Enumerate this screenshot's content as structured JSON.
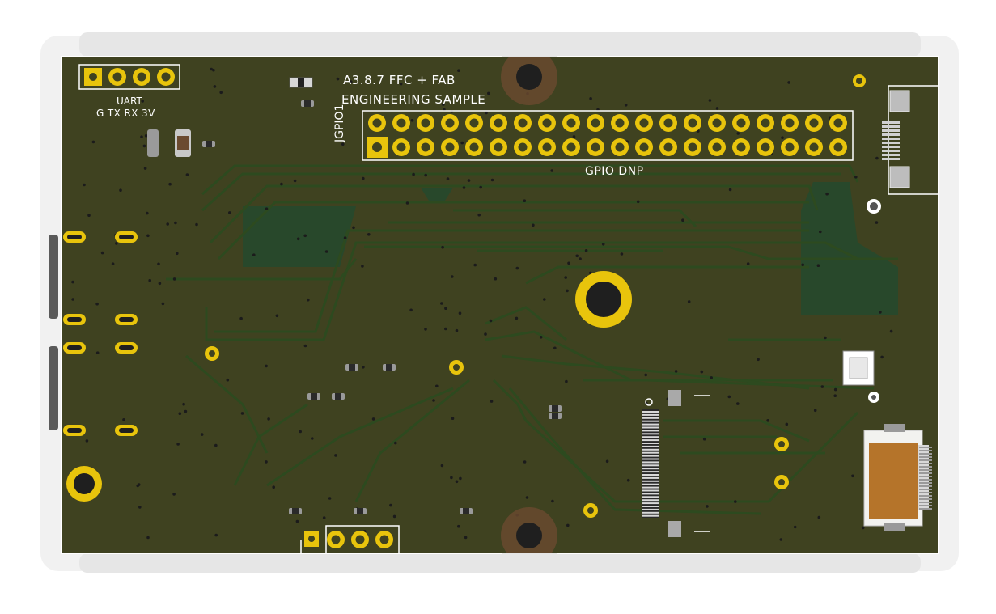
{
  "board": {
    "title_line1": "A3.8.7 FFC + FAB",
    "title_line2": "ENGINEERING SAMPLE",
    "uart_label": "UART",
    "uart_pins": "G TX RX 3V",
    "gpio_label": "GPIO DNP",
    "gpio_ref": "JGPIO1"
  },
  "colors": {
    "substrate": "#3f4220",
    "copper_trace": "#2d4a1f",
    "copper_pour": "#26492c",
    "pad_gold": "#e8c40c",
    "silkscreen": "#ffffff",
    "fpc_connector": "#b5742a"
  },
  "headers": {
    "gpio_pin_columns": 20,
    "gpio_pin_rows": 2,
    "uart_pins": 4,
    "bottom_header_pins": 4
  },
  "icons": {
    "mounting_hole": "mounting-hole-icon",
    "usb_port": "usb-c-connector-icon",
    "fpc_connector": "ffc-connector-icon"
  }
}
